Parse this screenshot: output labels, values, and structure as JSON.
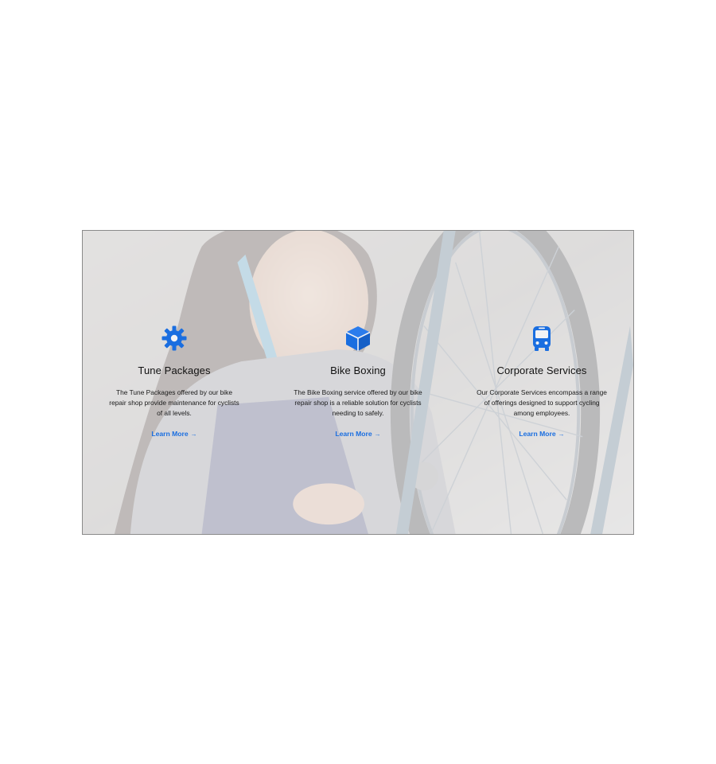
{
  "colors": {
    "accent": "#1a6ee0",
    "title_text": "#111111",
    "body_text": "#1a1a1a",
    "overlay": "#f2f2f4"
  },
  "background": {
    "image_description_icon": "bike-mechanic-photo"
  },
  "services": [
    {
      "icon": "gear-icon",
      "title": "Tune Packages",
      "description": "The Tune Packages offered by our bike repair shop provide maintenance for cyclists of all levels.",
      "link_label": "Learn More",
      "link_arrow": "→"
    },
    {
      "icon": "box-icon",
      "title": "Bike Boxing",
      "description": "The Bike Boxing service offered by our bike repair shop is a reliable solution for cyclists needing to safely.",
      "link_label": "Learn More",
      "link_arrow": "→"
    },
    {
      "icon": "bus-icon",
      "title": "Corporate Services",
      "description": "Our Corporate Services encompass a range of offerings designed to support cycling among employees.",
      "link_label": "Learn More",
      "link_arrow": "→"
    }
  ]
}
